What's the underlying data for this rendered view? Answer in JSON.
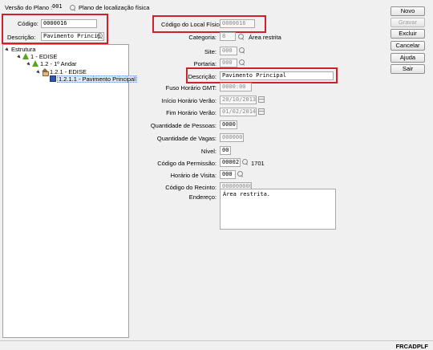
{
  "top": {
    "versao_label": "Versão do Plano :",
    "versao_value": "001",
    "plano_label": "Plano de localização física"
  },
  "filters": {
    "codigo_label": "Código:",
    "codigo_value": "0000016",
    "descricao_label": "Descrição:",
    "descricao_value": "Pavimento Princip"
  },
  "tree": {
    "root": "Estrutura",
    "items": [
      "1 - EDISE",
      "1.2 - 1º Andar",
      "1.2.1 - EDISE",
      "1.2.1.1 - Pavimento Principal"
    ]
  },
  "form": {
    "codigo_local_label": "Código do Local Físico:",
    "codigo_local_value": "0000016",
    "categoria_label": "Categoria:",
    "categoria_value": "8",
    "categoria_desc": "Área restrita",
    "site_label": "Site:",
    "site_value": "000",
    "portaria_label": "Portaria:",
    "portaria_value": "000",
    "descricao_label": "Descrição:",
    "descricao_value": "Pavimento Principal",
    "fuso_label": "Fuso Horário GMT:",
    "fuso_value": "0000:00",
    "inicio_label": "Início Horário Verão:",
    "inicio_value": "20/10/2013",
    "fim_label": "Fim Horário Verão:",
    "fim_value": "01/02/2014",
    "qtd_pessoas_label": "Quantidade de Pessoas:",
    "qtd_pessoas_value": "0000",
    "qtd_vagas_label": "Quantidade de Vagas:",
    "qtd_vagas_value": "000000",
    "nivel_label": "Nível:",
    "nivel_value": "00",
    "permissao_label": "Código da Permissão:",
    "permissao_value": "00002",
    "permissao_desc": "1701",
    "visita_label": "Horário de Visita:",
    "visita_value": "000",
    "recinto_label": "Código do Recinto:",
    "recinto_value": "000000000",
    "endereco_label": "Endereço:",
    "endereco_value": "Área restrita."
  },
  "buttons": {
    "novo": "Novo",
    "gravar": "Gravar",
    "excluir": "Excluir",
    "cancelar": "Cancelar",
    "ajuda": "Ajuda",
    "sair": "Sair"
  },
  "status": {
    "program": "FRCADPLF"
  }
}
